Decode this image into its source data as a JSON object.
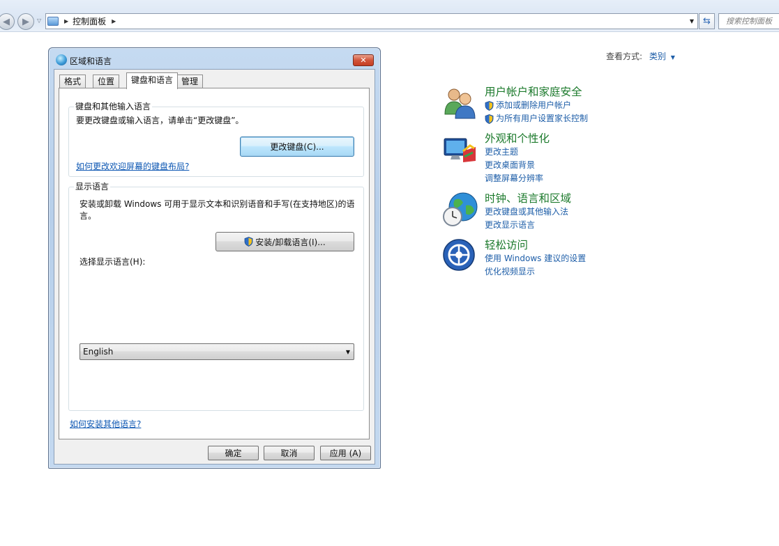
{
  "window": {
    "address_path": "控制面板",
    "search_placeholder": "搜索控制面板"
  },
  "control_panel": {
    "view_by_label": "查看方式:",
    "view_by_value": "类别",
    "categories": [
      {
        "icon": "users-icon",
        "title": "用户帐户和家庭安全",
        "links": [
          "添加或删除用户帐户",
          "为所有用户设置家长控制"
        ],
        "shielded": [
          true,
          true
        ]
      },
      {
        "icon": "appearance-icon",
        "title": "外观和个性化",
        "links": [
          "更改主题",
          "更改桌面背景",
          "调整屏幕分辨率"
        ]
      },
      {
        "icon": "clock-globe-icon",
        "title": "时钟、语言和区域",
        "links": [
          "更改键盘或其他输入法",
          "更改显示语言"
        ]
      },
      {
        "icon": "ease-of-access-icon",
        "title": "轻松访问",
        "links": [
          "使用 Windows 建议的设置",
          "优化视频显示"
        ]
      }
    ]
  },
  "dialog": {
    "title": "区域和语言",
    "close_glyph": "✕",
    "tabs": [
      "格式",
      "位置",
      "键盘和语言",
      "管理"
    ],
    "active_tab": "键盘和语言",
    "keyboard_group": {
      "label": "键盘和其他输入语言",
      "description": "要更改键盘或输入语言，请单击“更改键盘”。",
      "change_keyboard_button": "更改键盘(C)...",
      "welcome_layout_link": "如何更改欢迎屏幕的键盘布局?"
    },
    "display_group": {
      "label": "显示语言",
      "description": "安装或卸载 Windows 可用于显示文本和识别语音和手写(在支持地区)的语言。",
      "install_button": "安装/卸载语言(I)...",
      "choose_label": "选择显示语言(H):",
      "selected_language": "English"
    },
    "install_more_link": "如何安装其他语言?",
    "buttons": {
      "ok": "确定",
      "cancel": "取消",
      "apply": "应用 (A)"
    }
  },
  "colors": {
    "category_title": "#1c7a2c",
    "link": "#1e5ea8",
    "dialog_frame": "#b7cfea"
  }
}
